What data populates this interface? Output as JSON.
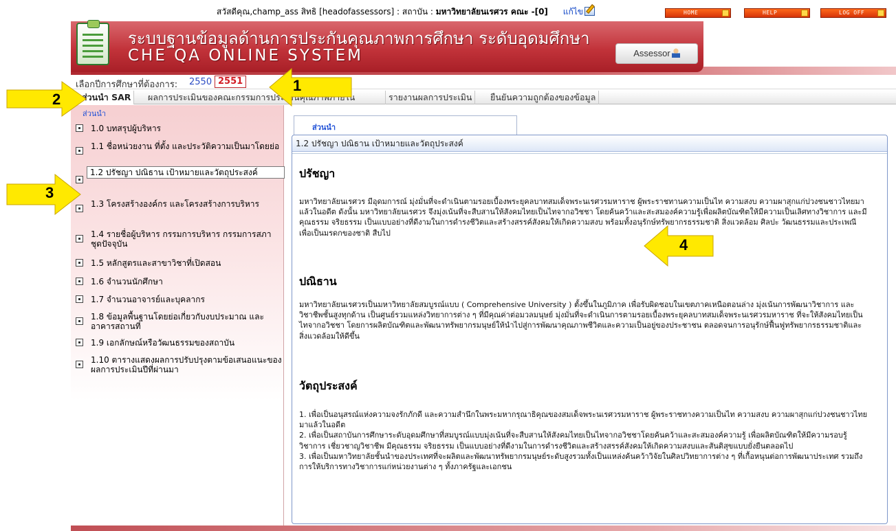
{
  "greeting": {
    "prefix": "สวัสดีคุณ,champ_ass สิทธิ [headofassessors] : สถาบัน : ",
    "institution": "มหาวิทยาลัยนเรศวร",
    "suffix": " คณะ -[0]",
    "edit_label": "แก้ไข"
  },
  "top_buttons": {
    "home": "HOME",
    "help": "HELP",
    "logoff": "LOG OFF"
  },
  "header": {
    "title_th": "ระบบฐานข้อมูลด้านการประกันคุณภาพการศึกษา ระดับอุดมศึกษา",
    "title_en": "CHE QA ONLINE SYSTEM",
    "role_button": "Assessor"
  },
  "year_select": {
    "label": "เลือกปีการศึกษาที่ต้องการ:",
    "years": [
      "2550",
      "2551"
    ],
    "selected": "2551"
  },
  "tabs": [
    "ส่วนนำ SAR",
    "ผลการประเมินของคณะกรรมการประเมินคุณภาพภายใน",
    "รายงานผลการประเมิน",
    "ยืนยันความถูกต้องของข้อมูล"
  ],
  "sidebar": {
    "title": "ส่วนนำ",
    "items": [
      "1.0 บทสรุปผู้บริหาร",
      "1.1 ชื่อหน่วยงาน ที่ตั้ง และประวัติความเป็นมาโดยย่อ",
      "1.2 ปรัชญา ปณิธาน เป้าหมายและวัตถุประสงค์",
      "1.3 โครงสร้างองค์กร และโครงสร้างการบริหาร",
      "1.4 รายชื่อผู้บริหาร กรรมการบริหาร กรรมการสภาชุดปัจจุบัน",
      "1.5 หลักสูตรและสาขาวิชาที่เปิดสอน",
      "1.6 จำนวนนักศึกษา",
      "1.7 จำนวนอาจารย์และบุคลากร",
      "1.8 ข้อมูลพื้นฐานโดยย่อเกี่ยวกับงบประมาณ และอาคารสถานที่",
      "1.9 เอกลักษณ์หรือวัฒนธรรมของสถาบัน",
      "1.10 ตารางแสดงผลการปรับปรุงตามข้อเสนอแนะของผลการประเมินปีที่ผ่านมา"
    ],
    "selected_index": 2
  },
  "content": {
    "tab_label": "ส่วนนำ",
    "panel_title": "1.2 ปรัชญา ปณิธาน เป้าหมายและวัตถุประสงค์",
    "sections": [
      {
        "heading": "ปรัชญา",
        "text": "มหาวิทยาลัยนเรศวร มีอุดมการณ์ มุ่งมั่นที่จะดำเนินตามรอยเบื้องพระยุคลบาทสมเด็จพระนเรศวรมหาราช ผู้พระราชทานความเป็นไท ความสงบ ความผาสุกแก่ปวงชนชาวไทยมาแล้วในอดีต ดังนั้น มหาวิทยาลัยนเรศวร จึงมุ่งเน้นที่จะสืบสานให้สังคมไทยเป็นไทจากอวิชชา โดยค้นคว้าและสะสมองค์ความรู้เพื่อผลิตบัณฑิตให้มีความเป็นเลิศทางวิชาการ และมีคุณธรรม จริยธรรม เป็นแบบอย่างที่ดีงามในการดำรงชีวิตและสร้างสรรค์สังคมให้เกิดความสงบ พร้อมทั้งอนุรักษ์ทรัพยากรธรรมชาติ สิ่งแวดล้อม ศิลปะ วัฒนธรรมและประเพณี เพื่อเป็นมรดกของชาติ สืบไป"
      },
      {
        "heading": "ปณิธาน",
        "text": "มหาวิทยาลัยนเรศวรเป็นมหาวิทยาลัยสมบูรณ์แบบ ( Comprehensive University ) ตั้งขึ้นในภูมิภาค เพื่อรับผิดชอบในเขตภาคเหนือตอนล่าง มุ่งเน้นการพัฒนาวิชาการ และวิชาชีพชั้นสูงทุกด้าน เป็นศูนย์รวมแหล่งวิทยาการต่าง ๆ ที่มีคุณค่าต่อมวลมนุษย์ มุ่งมั่นที่จะดำเนินการตามรอยเบื้องพระยุคลบาทสมเด็จพระนเรศวรมหาราช ที่จะให้สังคมไทยเป็นไทจากอวิชชา โดยการผลิตบัณฑิตและพัฒนาทรัพยากรมนุษย์ให้นำไปสู่การพัฒนาคุณภาพชีวิตและความเป็นอยู่ของประชาชน ตลอดจนการอนุรักษ์ฟื้นฟูทรัพยากรธรรมชาติและสิ่งแวดล้อมให้ดีขึ้น"
      },
      {
        "heading": "วัตถุประสงค์",
        "text": "1. เพื่อเป็นอนุสรณ์แห่งความจงรักภักดี และความสำนึกในพระมหากรุณาธิคุณของสมเด็จพระนเรศวรมหาราช ผู้พระราชทางความเป็นไท ความสงบ ความผาสุกแก่ปวงชนชาวไทยมาแล้วในอดีต\n2. เพื่อเป็นสถาบันการศึกษาระดับอุดมศึกษาที่สมบูรณ์แบบมุ่งเน้นที่จะสืบสานให้สังคมไทยเป็นไทจากอวิชชาโดยค้นคว้าและสะสมองค์ความรู้ เพื่อผลิตบัณฑิตให้มีความรอบรู้วิชาการ เชี่ยวชาญวิชาชีพ มีคุณธรรม จริยธรรม เป็นแบบอย่างที่ดีงามในการดำรงชีวิตและสร้างสรรค์สังคมให้เกิดความสงบและสันติสุขแบบยั่งยืนตลอดไป\n3. เพื่อเป็นมหาวิทยาลัยชั้นนำของประเทศที่จะผลิตและพัฒนาทรัพยากรมนุษย์ระดับสูงรวมทั้งเป็นแหล่งค้นคว้าวิจัยในศิลปวิทยาการต่าง ๆ ที่เกื้อหนุนต่อการพัฒนาประเทศ รวมถึงการให้บริการทางวิชาการแก่หน่วยงานต่าง ๆ ทั้งภาครัฐและเอกชน"
      }
    ]
  },
  "callouts": [
    "1",
    "2",
    "3",
    "4"
  ],
  "colors": {
    "header": "#c2333a",
    "callout": "#ffe900",
    "link": "#1e4fd6",
    "selected_year": "#d11a22"
  }
}
